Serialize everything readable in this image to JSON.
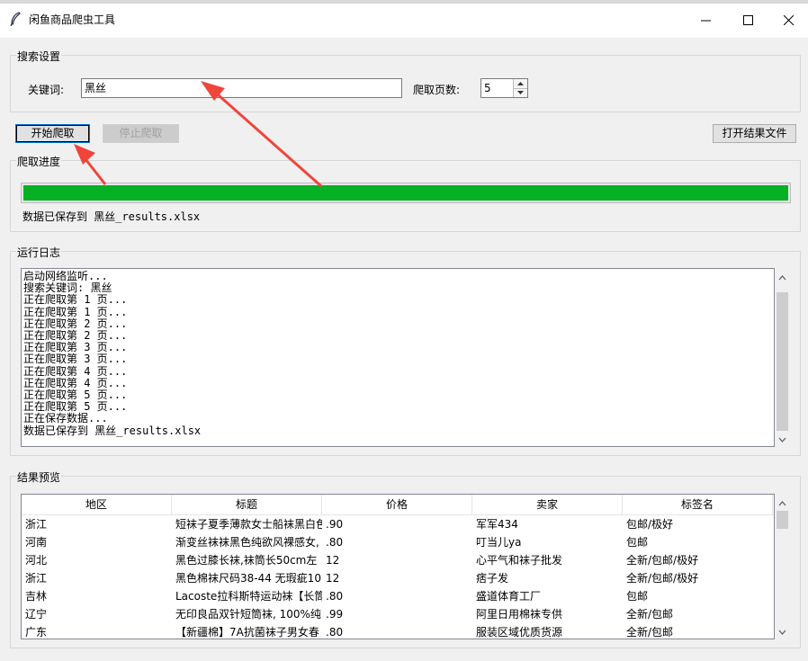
{
  "window": {
    "title": "闲鱼商品爬虫工具"
  },
  "search_settings": {
    "group_label": "搜索设置",
    "keyword_label": "关键词:",
    "keyword_value": "黑丝",
    "pages_label": "爬取页数:",
    "pages_value": "5"
  },
  "controls": {
    "start_label": "开始爬取",
    "stop_label": "停止爬取",
    "open_label": "打开结果文件"
  },
  "progress": {
    "group_label": "爬取进度",
    "percent": 100,
    "status": "数据已保存到 黑丝_results.xlsx"
  },
  "log": {
    "group_label": "运行日志",
    "lines": [
      "启动网络监听...",
      "搜索关键词: 黑丝",
      "正在爬取第 1 页...",
      "正在爬取第 1 页...",
      "正在爬取第 2 页...",
      "正在爬取第 2 页...",
      "正在爬取第 3 页...",
      "正在爬取第 3 页...",
      "正在爬取第 4 页...",
      "正在爬取第 4 页...",
      "正在爬取第 5 页...",
      "正在爬取第 5 页...",
      "正在保存数据...",
      "数据已保存到 黑丝_results.xlsx"
    ]
  },
  "results": {
    "group_label": "结果预览",
    "columns": [
      "地区",
      "标题",
      "价格",
      "卖家",
      "标签名"
    ],
    "rows": [
      [
        "浙江",
        "短袜子夏季薄款女士船袜黑白色",
        ".90",
        "军军434",
        "包邮/极好"
      ],
      [
        "河南",
        "渐变丝袜袜黑色纯欲风裸感女,",
        ".80",
        "叮当儿ya",
        "包邮"
      ],
      [
        "河北",
        "黑色过膝长袜,袜筒长50cm左",
        "12",
        "心平气和袜子批发",
        "全新/包邮/极好"
      ],
      [
        "浙江",
        "黑色棉袜尺码38-44 无瑕疵10",
        "12",
        "痞子发",
        "全新/包邮/极好"
      ],
      [
        "吉林",
        "Lacoste拉科斯特运动袜【长筒",
        ".80",
        "盛道体育工厂",
        "包邮"
      ],
      [
        "辽宁",
        "无印良品双针短筒袜, 100%纯",
        ".99",
        "阿里日用棉袜专供",
        "全新/包邮"
      ],
      [
        "广东",
        "【新疆棉】7A抗菌袜子男女春",
        ".80",
        "服装区域优质货源",
        "全新/包邮"
      ]
    ]
  },
  "colors": {
    "progress_fill": "#06b025",
    "annotation_arrow": "#f0453a"
  }
}
